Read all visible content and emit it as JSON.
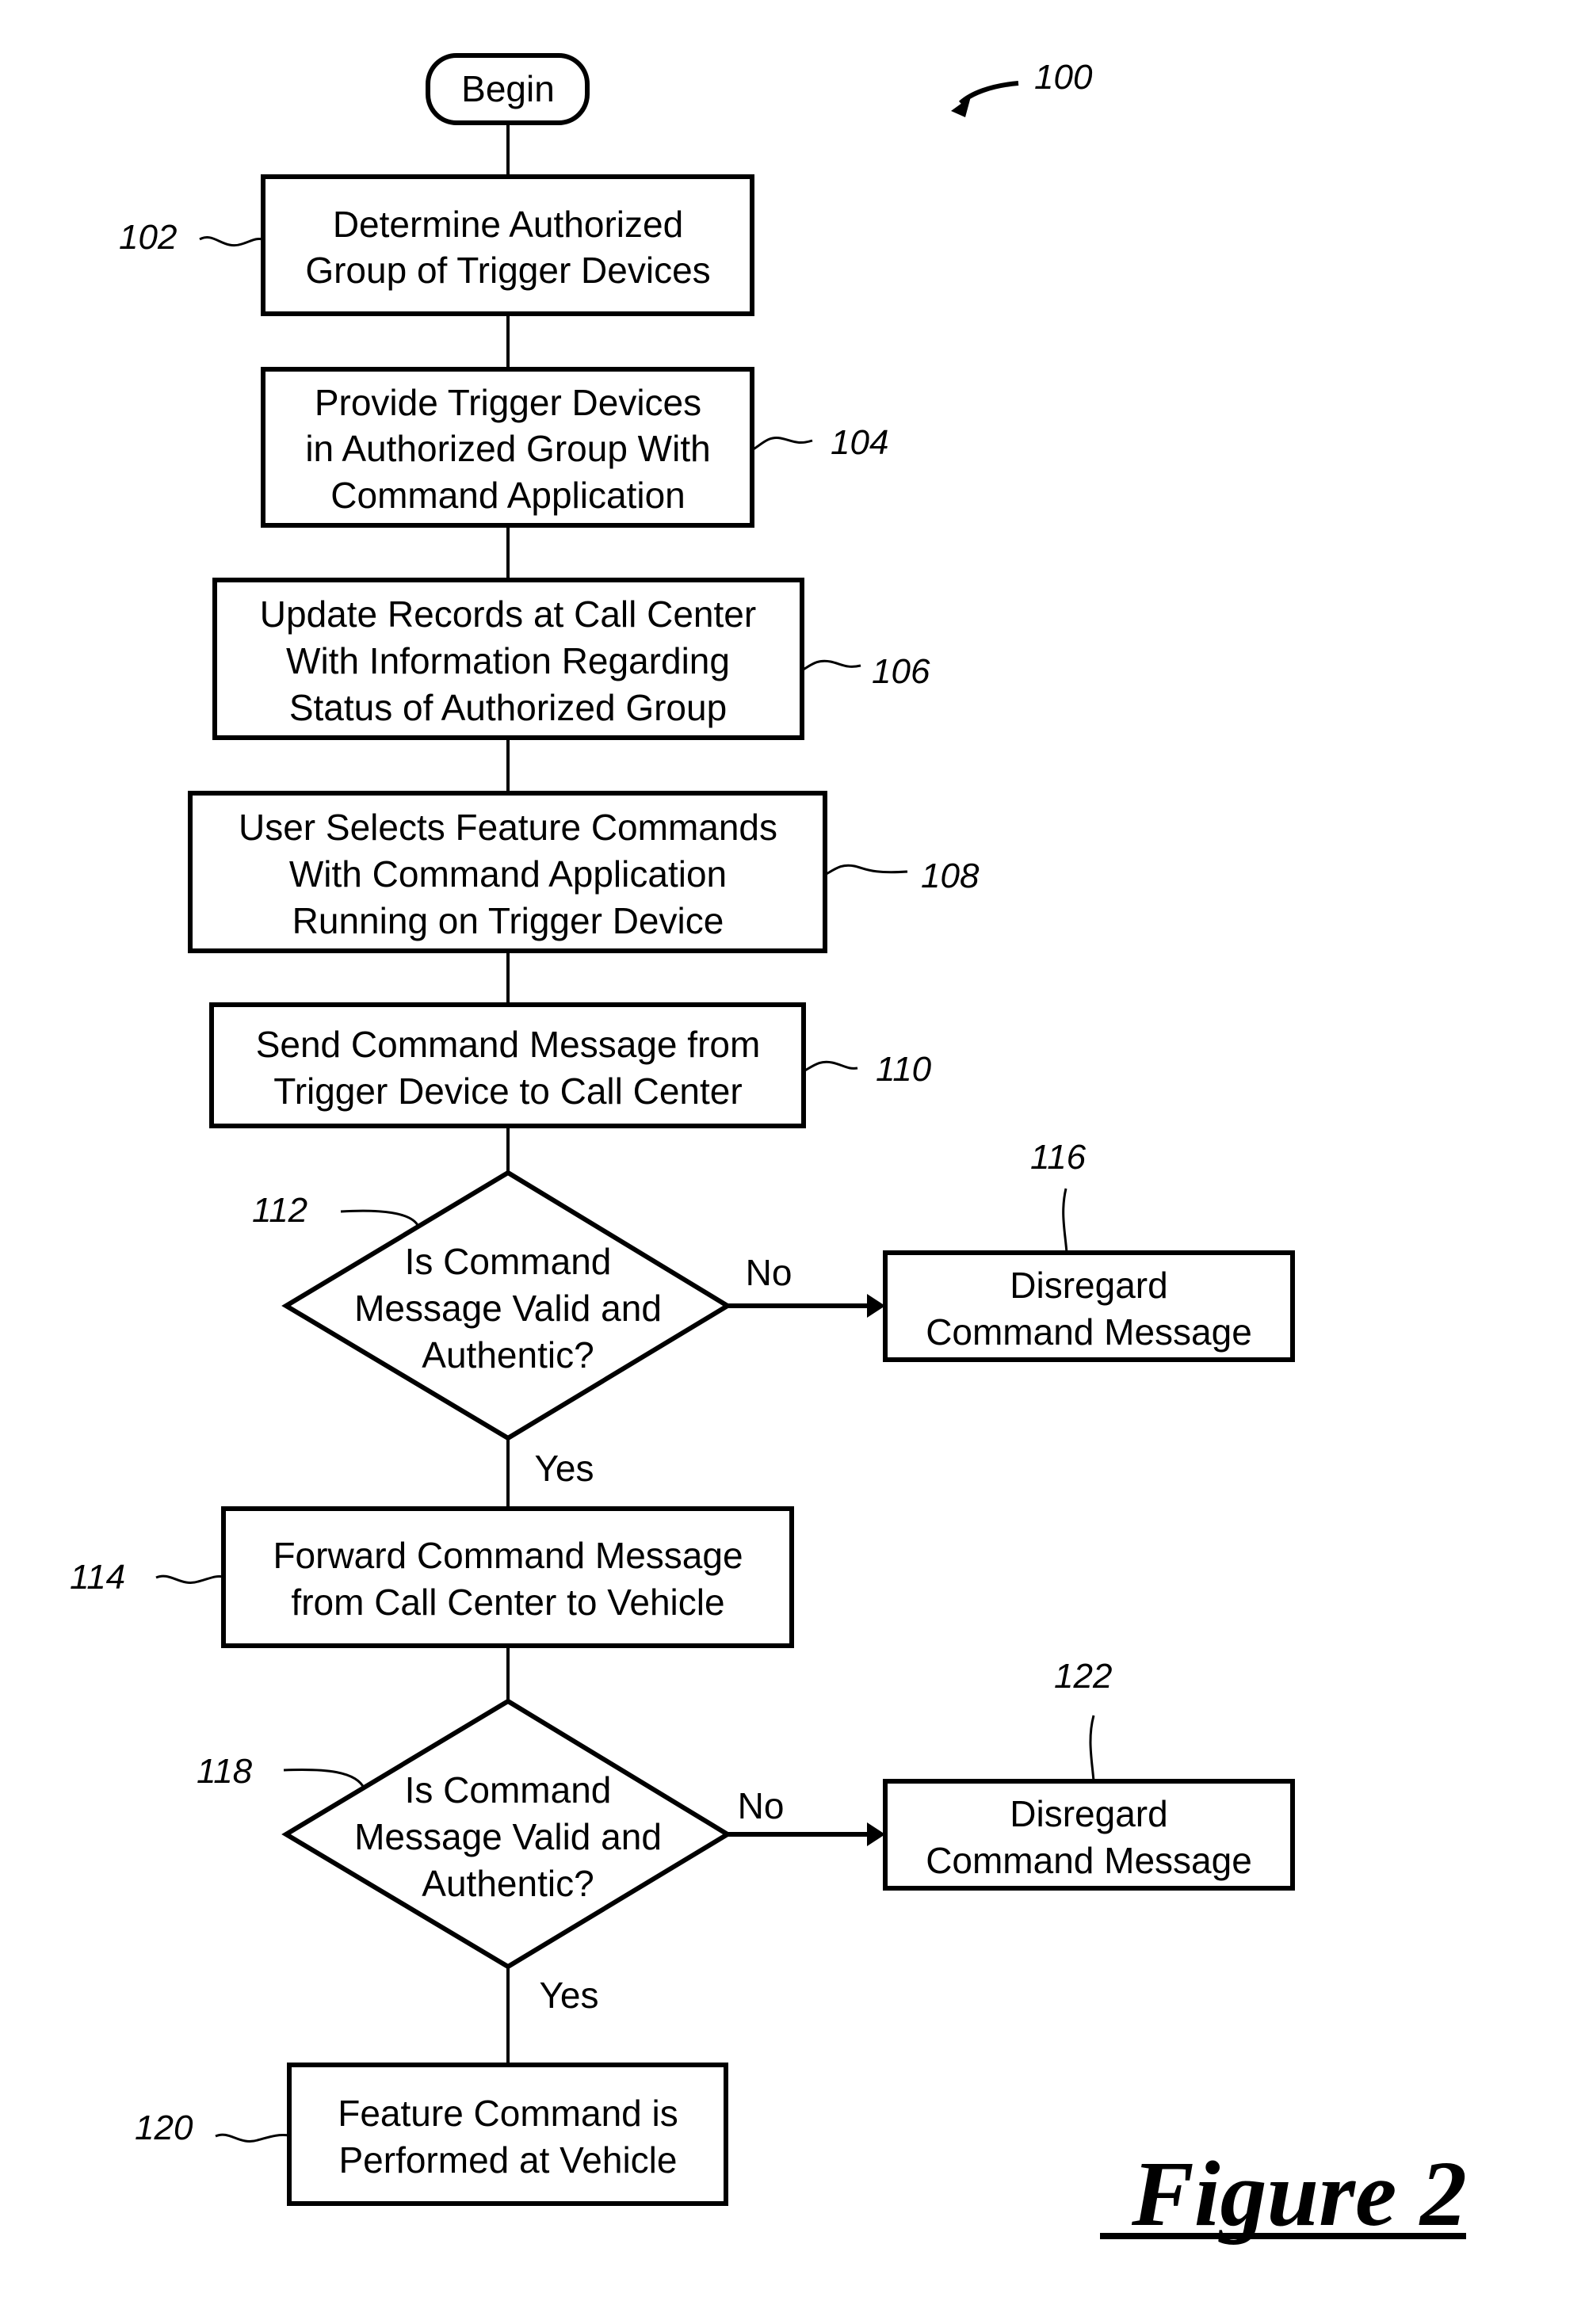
{
  "figure": {
    "ref": "100",
    "caption": "Figure 2"
  },
  "begin": {
    "label": "Begin"
  },
  "steps": {
    "s102": {
      "ref": "102",
      "lines": [
        "Determine Authorized",
        "Group of Trigger Devices"
      ]
    },
    "s104": {
      "ref": "104",
      "lines": [
        "Provide Trigger Devices",
        "in Authorized Group With",
        "Command Application"
      ]
    },
    "s106": {
      "ref": "106",
      "lines": [
        "Update Records at Call Center",
        "With Information Regarding",
        "Status of Authorized Group"
      ]
    },
    "s108": {
      "ref": "108",
      "lines": [
        "User Selects Feature Commands",
        "With Command Application",
        "Running on Trigger Device"
      ]
    },
    "s110": {
      "ref": "110",
      "lines": [
        "Send Command Message from",
        "Trigger Device to Call Center"
      ]
    },
    "d112": {
      "ref": "112",
      "lines": [
        "Is Command",
        "Message Valid and",
        "Authentic?"
      ],
      "no": "No",
      "yes": "Yes"
    },
    "s116": {
      "ref": "116",
      "lines": [
        "Disregard",
        "Command Message"
      ]
    },
    "s114": {
      "ref": "114",
      "lines": [
        "Forward Command Message",
        "from Call Center to Vehicle"
      ]
    },
    "d118": {
      "ref": "118",
      "lines": [
        "Is Command",
        "Message Valid and",
        "Authentic?"
      ],
      "no": "No",
      "yes": "Yes"
    },
    "s122": {
      "ref": "122",
      "lines": [
        "Disregard",
        "Command Message"
      ]
    },
    "s120": {
      "ref": "120",
      "lines": [
        "Feature Command is",
        "Performed at Vehicle"
      ]
    }
  }
}
